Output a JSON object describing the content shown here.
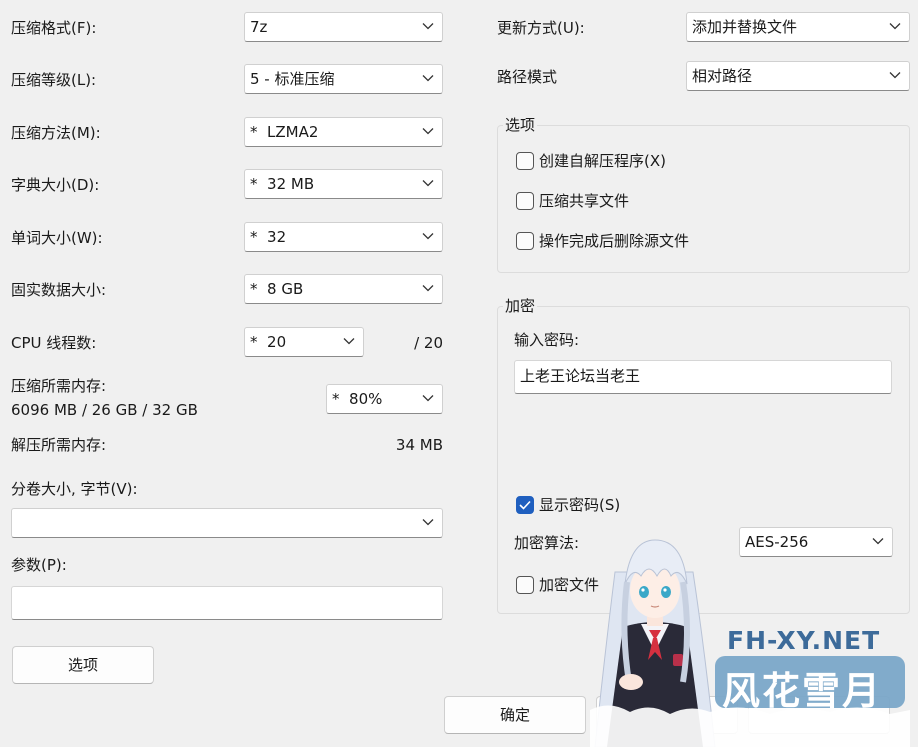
{
  "left": {
    "format_label": "压缩格式(F):",
    "format_value": "7z",
    "level_label": "压缩等级(L):",
    "level_value": "5 - 标准压缩",
    "method_label": "压缩方法(M):",
    "method_value": "*  LZMA2",
    "dict_label": "字典大小(D):",
    "dict_value": "*  32 MB",
    "word_label": "单词大小(W):",
    "word_value": "*  32",
    "solid_label": "固实数据大小:",
    "solid_value": "*  8 GB",
    "threads_label": "CPU 线程数:",
    "threads_value": "*  20",
    "threads_max": "/ 20",
    "mem_label": "压缩所需内存:",
    "mem_detail": "6096 MB / 26 GB / 32 GB",
    "mem_value": "*  80%",
    "decomp_label": "解压所需内存:",
    "decomp_value": "34 MB",
    "volume_label": "分卷大小, 字节(V):",
    "volume_value": "",
    "params_label": "参数(P):",
    "params_value": "",
    "options_button": "选项"
  },
  "right": {
    "update_label": "更新方式(U):",
    "update_value": "添加并替换文件",
    "path_label": "路径模式",
    "path_value": "相对路径",
    "options_group": "选项",
    "opt_sfx": "创建自解压程序(X)",
    "opt_shared": "压缩共享文件",
    "opt_delete": "操作完成后删除源文件",
    "enc_group": "加密",
    "pwd_label": "输入密码:",
    "pwd_value": "上老王论坛当老王",
    "show_pwd": "显示密码(S)",
    "algo_label": "加密算法:",
    "algo_value": "AES-256",
    "enc_names": "加密文件",
    "ok_button": "确定"
  },
  "watermark": {
    "site": "FH-XY.NET",
    "name": "风花雪月"
  },
  "colors": {
    "accent": "#1f5fbf",
    "window_bg": "#f0f0f0"
  },
  "icons": {
    "dropdown": "chevron-down-icon",
    "check": "checkmark-icon"
  }
}
